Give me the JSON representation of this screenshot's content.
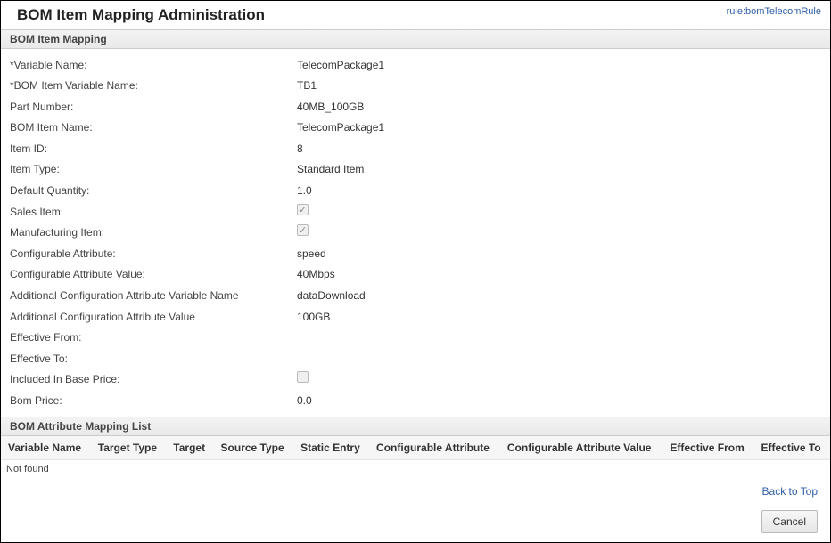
{
  "header": {
    "title": "BOM Item Mapping Administration",
    "rule_link": "rule:bomTelecomRule"
  },
  "section1": {
    "title": "BOM Item Mapping"
  },
  "fields": {
    "variable_name": {
      "label": "*Variable Name:",
      "value": "TelecomPackage1"
    },
    "bom_item_variable_name": {
      "label": "*BOM Item Variable Name:",
      "value": "TB1"
    },
    "part_number": {
      "label": "Part Number:",
      "value": "40MB_100GB"
    },
    "bom_item_name": {
      "label": "BOM Item Name:",
      "value": "TelecomPackage1"
    },
    "item_id": {
      "label": "Item ID:",
      "value": "8"
    },
    "item_type": {
      "label": "Item Type:",
      "value": "Standard Item"
    },
    "default_quantity": {
      "label": "Default Quantity:",
      "value": "1.0"
    },
    "sales_item": {
      "label": "Sales Item:",
      "checked": true
    },
    "manufacturing_item": {
      "label": "Manufacturing Item:",
      "checked": true
    },
    "configurable_attribute": {
      "label": "Configurable Attribute:",
      "value": "speed"
    },
    "configurable_attribute_value": {
      "label": "Configurable Attribute Value:",
      "value": "40Mbps"
    },
    "addl_config_attr_var_name": {
      "label": "Additional Configuration Attribute Variable Name",
      "value": "dataDownload"
    },
    "addl_config_attr_value": {
      "label": "Additional Configuration Attribute Value",
      "value": "100GB"
    },
    "effective_from": {
      "label": "Effective From:",
      "value": ""
    },
    "effective_to": {
      "label": "Effective To:",
      "value": ""
    },
    "included_in_base_price": {
      "label": "Included In Base Price:",
      "checked": false
    },
    "bom_price": {
      "label": "Bom Price:",
      "value": "0.0"
    }
  },
  "section2": {
    "title": "BOM Attribute Mapping List"
  },
  "table": {
    "columns": [
      "Variable Name",
      "Target Type",
      "Target",
      "Source Type",
      "Static Entry",
      "Configurable Attribute",
      "Configurable Attribute Value",
      "Effective From",
      "Effective To"
    ],
    "empty_text": "Not found"
  },
  "footer": {
    "back_to_top": "Back to Top",
    "cancel": "Cancel"
  }
}
